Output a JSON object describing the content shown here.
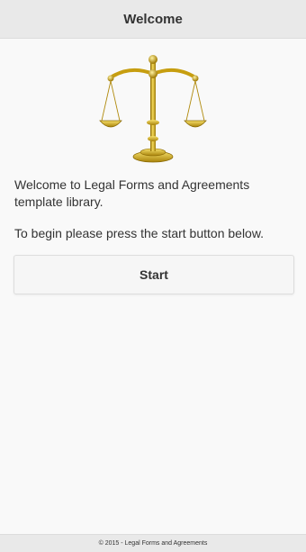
{
  "header": {
    "title": "Welcome"
  },
  "logo": {
    "icon": "scales-of-justice-icon",
    "color": "#d8b31a"
  },
  "main": {
    "intro_text": "Welcome to Legal Forms and Agreements template library.",
    "instruction_text": "To begin please press the start button below.",
    "start_label": "Start"
  },
  "footer": {
    "text": "© 2015 - Legal Forms and Agreements"
  },
  "colors": {
    "background": "#f9f9f9",
    "bar": "#e9e9e9",
    "text": "#333333",
    "gold": "#d8b31a"
  }
}
